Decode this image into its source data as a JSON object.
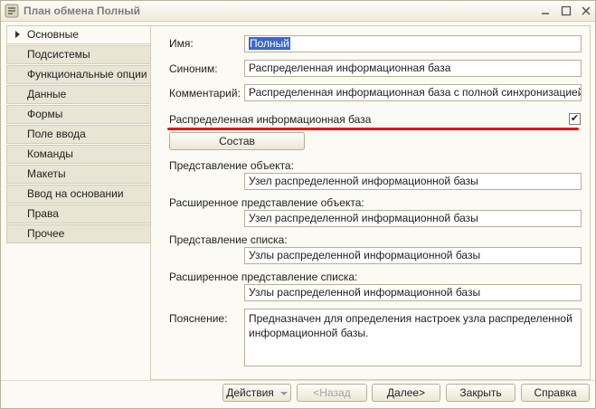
{
  "window": {
    "title": "План обмена Полный"
  },
  "tabs": [
    {
      "label": "Основные",
      "active": true
    },
    {
      "label": "Подсистемы"
    },
    {
      "label": "Функциональные опции"
    },
    {
      "label": "Данные"
    },
    {
      "label": "Формы"
    },
    {
      "label": "Поле ввода"
    },
    {
      "label": "Команды"
    },
    {
      "label": "Макеты"
    },
    {
      "label": "Ввод на основании"
    },
    {
      "label": "Права"
    },
    {
      "label": "Прочее"
    }
  ],
  "form": {
    "name_label": "Имя:",
    "name_value": "Полный",
    "synonym_label": "Синоним:",
    "synonym_value": "Распределенная информационная база",
    "comment_label": "Комментарий:",
    "comment_value": "Распределенная информационная база с полной синхронизацией данных",
    "distributed_label": "Распределенная информационная база",
    "distributed_checked": true,
    "check_mark": "✔",
    "composition_button": "Состав",
    "object_repr_label": "Представление объекта:",
    "object_repr_value": "Узел распределенной информационной базы",
    "ext_object_repr_label": "Расширенное представление объекта:",
    "ext_object_repr_value": "Узел распределенной информационной базы",
    "list_repr_label": "Представление списка:",
    "list_repr_value": "Узлы распределенной информационной базы",
    "ext_list_repr_label": "Расширенное представление списка:",
    "ext_list_repr_value": "Узлы распределенной информационной базы",
    "explanation_label": "Пояснение:",
    "explanation_value": "Предназначен для определения настроек узла распределенной информационной базы."
  },
  "buttons": {
    "actions": "Действия",
    "back": "<Назад",
    "next": "Далее>",
    "close": "Закрыть",
    "help": "Справка"
  },
  "colors": {
    "accent_underline": "#e01818",
    "selection": "#3a67c8"
  },
  "icons": {
    "app": "metadata-object-icon",
    "minimize": "minimize-icon",
    "maximize": "maximize-icon",
    "close": "close-icon"
  }
}
